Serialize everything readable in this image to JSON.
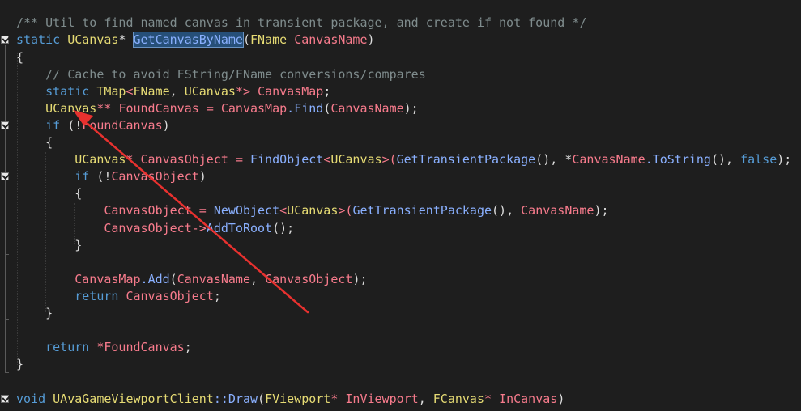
{
  "editor": {
    "lines": {
      "l1": {
        "comment": "/** Util to find named canvas in transient package, and create if not found */"
      },
      "l2": {
        "kw": "static",
        "type": "UCanvas",
        "ptr": "*",
        "fn": "GetCanvasByName",
        "open": "(",
        "ptype": "FName",
        "pname": "CanvasName",
        "close": ")"
      },
      "l3": {
        "brace": "{"
      },
      "l4": {
        "comment": "// Cache to avoid FString/FName conversions/compares"
      },
      "l5": {
        "kw": "static",
        "type": "TMap",
        "lt": "<",
        "a1": "FName",
        "comma": ",",
        "a2": "UCanvas",
        "gt": "*>",
        "var": "CanvasMap",
        "semi": ";"
      },
      "l6": {
        "type": "UCanvas",
        "ptr": "**",
        "var": "FoundCanvas",
        "eq": "=",
        "obj": "CanvasMap",
        "dot": ".",
        "fn": "Find",
        "open": "(",
        "arg": "CanvasName",
        "close": ");"
      },
      "l7": {
        "kw": "if",
        "open": "(!",
        "var": "FoundCanvas",
        "close": ")"
      },
      "l8": {
        "brace": "{"
      },
      "l9": {
        "type": "UCanvas",
        "ptr": "*",
        "var": "CanvasObject",
        "eq": "=",
        "fn": "FindObject",
        "lt": "<",
        "targ": "UCanvas",
        "gt": ">(",
        "fn2": "GetTransientPackage",
        "mid": "(), *",
        "var2": "CanvasName",
        "dot": ".",
        "fn3": "ToString",
        "mid2": "(), ",
        "kw": "false",
        "close": ");"
      },
      "l10": {
        "kw": "if",
        "open": "(!",
        "var": "CanvasObject",
        "close": ")"
      },
      "l11": {
        "brace": "{"
      },
      "l12": {
        "var": "CanvasObject",
        "eq": "=",
        "fn": "NewObject",
        "lt": "<",
        "targ": "UCanvas",
        "gt": ">(",
        "fn2": "GetTransientPackage",
        "mid": "(), ",
        "var2": "CanvasName",
        "close": ");"
      },
      "l13": {
        "var": "CanvasObject",
        "arrow": "->",
        "fn": "AddToRoot",
        "close": "();"
      },
      "l14": {
        "brace": "}"
      },
      "l15": {
        "obj": "CanvasMap",
        "dot": ".",
        "fn": "Add",
        "open": "(",
        "a1": "CanvasName",
        "comma": ", ",
        "a2": "CanvasObject",
        "close": ");"
      },
      "l16": {
        "kw": "return",
        "var": "CanvasObject",
        "semi": ";"
      },
      "l17": {
        "brace": "}"
      },
      "l18": {
        "kw": "return",
        "deref": "*",
        "var": "FoundCanvas",
        "semi": ";"
      },
      "l19": {
        "brace": "}"
      },
      "l20": {
        "kw": "void",
        "type": "UAvaGameViewportClient",
        "scope": "::",
        "fn": "Draw",
        "open": "(",
        "t1": "FViewport",
        "ptr1": "*",
        "n1": "InViewport",
        "comma": ",",
        "t2": "FCanvas",
        "ptr2": "*",
        "n2": "InCanvas",
        "close": ")"
      }
    }
  },
  "annotation": {
    "color": "#e8312f"
  }
}
